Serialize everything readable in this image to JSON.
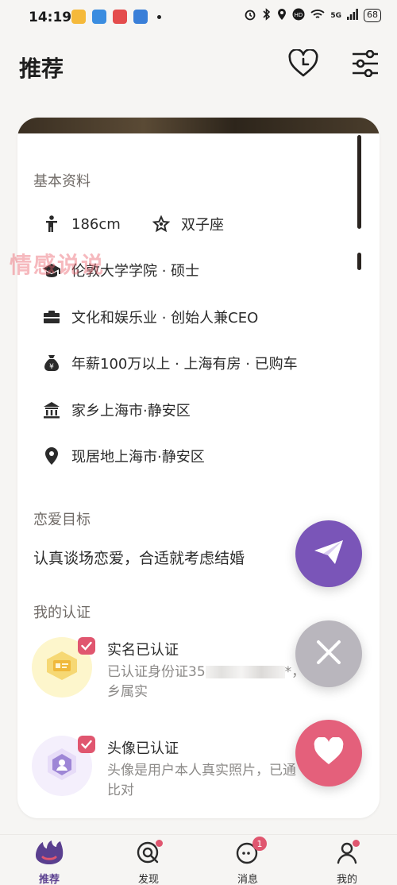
{
  "status_bar": {
    "time": "14:19",
    "network": "5G",
    "battery": "68"
  },
  "header": {
    "title": "推荐",
    "icons": [
      "heart-clock-icon",
      "filter-sliders-icon"
    ]
  },
  "watermark": "情感说说",
  "profile": {
    "basic_info": {
      "title": "基本资料",
      "height": "186cm",
      "zodiac": "双子座",
      "education": "伦敦大学学院 · 硕士",
      "work": "文化和娱乐业 · 创始人兼CEO",
      "finance": "年薪100万以上 · 上海有房 · 已购车",
      "hometown": "家乡上海市·静安区",
      "residence": "现居地上海市·静安区"
    },
    "love_goal": {
      "title": "恋爱目标",
      "text": "认真谈场恋爱，合适就考虑结婚"
    },
    "verification": {
      "title": "我的认证",
      "items": [
        {
          "title": "实名已认证",
          "desc_line1": "已认证身份证35",
          "desc_tail": "*，年",
          "desc_line2": "乡属实"
        },
        {
          "title": "头像已认证",
          "desc_line1": "头像是用户本人真实照片，已通",
          "desc_line2": "比对"
        }
      ]
    }
  },
  "fabs": {
    "send_color": "#7a55b8",
    "close_color": "#b9b6bd",
    "like_color": "#e4607b"
  },
  "bottom_nav": {
    "tabs": [
      {
        "label": "推荐",
        "active": true
      },
      {
        "label": "发现",
        "dot": true
      },
      {
        "label": "消息",
        "badge": "1"
      },
      {
        "label": "我的",
        "dot": true
      }
    ]
  },
  "colors": {
    "accent": "#5a3f8f",
    "badge_red": "#e0566f",
    "background": "#f6f5f3"
  }
}
